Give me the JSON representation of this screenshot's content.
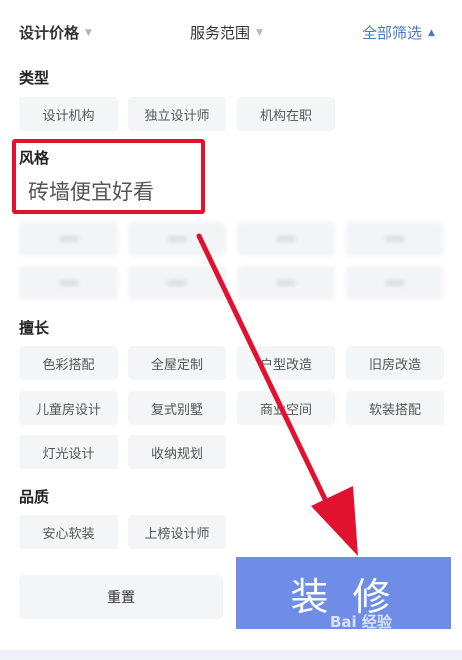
{
  "filters": [
    {
      "label": "设计价格",
      "caret": "▼"
    },
    {
      "label": "服务范围",
      "caret": "▼"
    },
    {
      "label": "全部筛选",
      "caret": "▲"
    }
  ],
  "sections": {
    "type": {
      "title": "类型",
      "options": [
        "设计机构",
        "独立设计师",
        "机构在职"
      ]
    },
    "style": {
      "title": "风格"
    },
    "expertise": {
      "title": "擅长",
      "options": [
        "色彩搭配",
        "全屋定制",
        "户型改造",
        "旧房改造",
        "儿童房设计",
        "复式别墅",
        "商业空间",
        "软装搭配",
        "灯光设计",
        "收纳规划"
      ]
    },
    "quality": {
      "title": "品质",
      "options": [
        "安心软装",
        "上榜设计师"
      ]
    }
  },
  "overlay_text": "砖墙便宜好看",
  "buttons": {
    "reset": "重置",
    "confirm": "装 修"
  },
  "watermark": "Bai 经验",
  "colors": {
    "accent_blue": "#4a78c2",
    "confirm_bg": "#6f8de6",
    "annotation_red": "#e1122f"
  },
  "icons": {
    "filter_caret": "caret-down-icon",
    "arrow": "red-arrow-annotation"
  }
}
